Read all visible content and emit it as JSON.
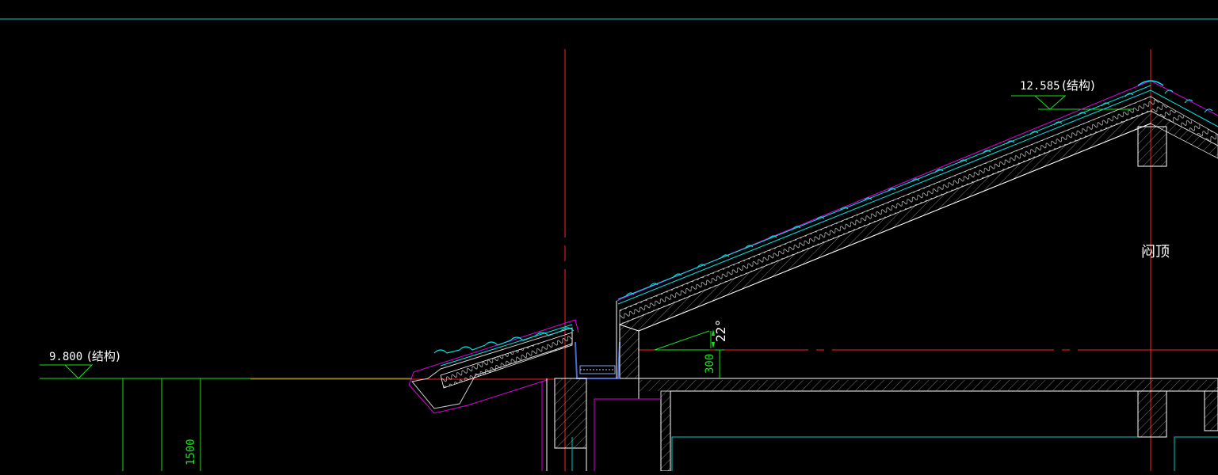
{
  "drawing": {
    "elevation_left": {
      "value": "9.800",
      "note": "(结构)"
    },
    "elevation_right": {
      "value": "12.585",
      "note": "(结构)"
    },
    "roof_angle": "22°",
    "dim_300": "300",
    "dim_1500": "1500",
    "ridge_label": "闷顶"
  },
  "colors": {
    "background": "#000000",
    "red": "#ff2020",
    "white": "#ffffff",
    "cyan": "#00e5e5",
    "magenta": "#e000e0",
    "green": "#19e619",
    "blue": "#4a6ad0",
    "gray": "#b0b0b0"
  }
}
